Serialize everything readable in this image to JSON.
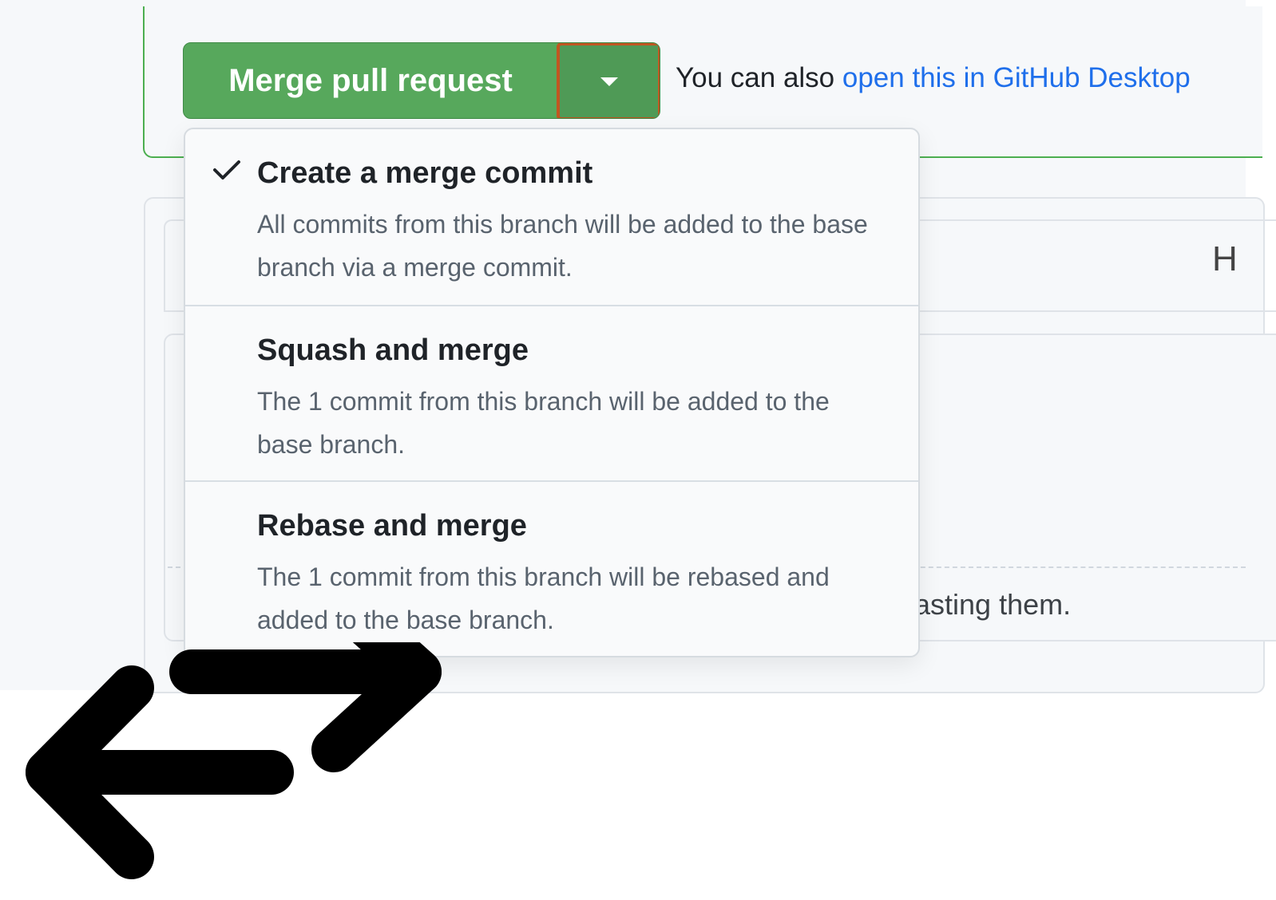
{
  "merge": {
    "button_label": "Merge pull request",
    "also_prefix": "You can also ",
    "desktop_link": "open this in GitHub Desktop"
  },
  "menu": {
    "items": [
      {
        "title": "Create a merge commit",
        "description": "All commits from this branch will be added to the base branch via a merge commit.",
        "selected": true
      },
      {
        "title": "Squash and merge",
        "description": "The 1 commit from this branch will be added to the base branch.",
        "selected": false
      },
      {
        "title": "Rebase and merge",
        "description": "The 1 commit from this branch will be rebased and added to the base branch.",
        "selected": false
      }
    ]
  },
  "background": {
    "partial_heading": "H",
    "partial_text": "asting them."
  },
  "colors": {
    "merge_green": "#57a85c",
    "highlight": "#c05621",
    "link": "#1f6feb"
  },
  "icons": [
    "chevron-down-icon",
    "checkmark-icon",
    "swap-arrows-icon"
  ]
}
